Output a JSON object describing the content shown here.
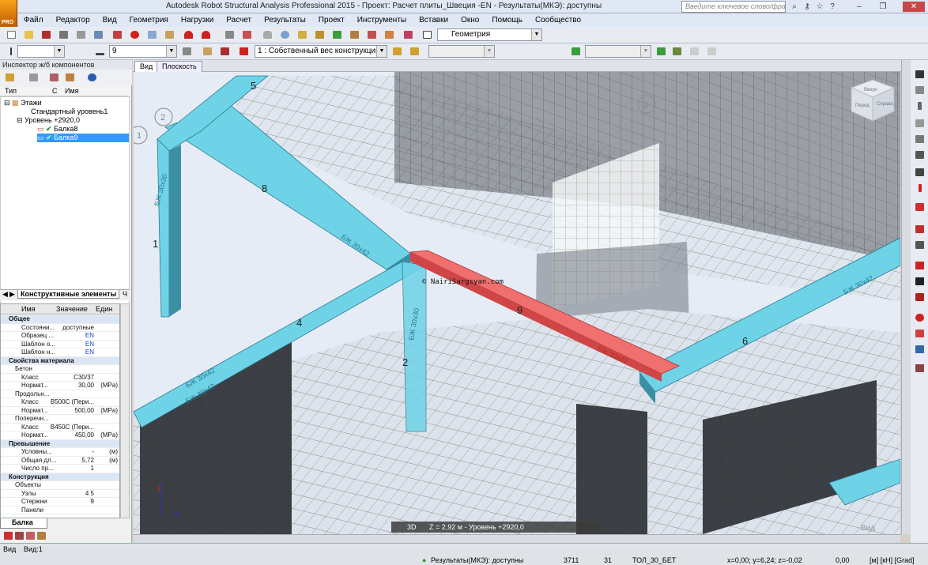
{
  "window": {
    "title": "Autodesk Robot Structural Analysis Professional 2015 - Проект: Расчет плиты_Швеция -EN - Результаты(МКЭ): доступны",
    "help_placeholder": "Введите ключевое слово/фразу",
    "logo_text": "PRO"
  },
  "menu": [
    "Файл",
    "Редактор",
    "Вид",
    "Геометрия",
    "Нагрузки",
    "Расчет",
    "Результаты",
    "Проект",
    "Инструменты",
    "Вставки",
    "Окно",
    "Помощь",
    "Сообщество"
  ],
  "toolbar": {
    "layout_combo": "Геометрия",
    "section_combo": "9",
    "load_case_combo": "1 : Собственный вес конструкций"
  },
  "inspector": {
    "title": "Инспектор ж/б компонентов",
    "columns": {
      "type": "Тип",
      "c": "С",
      "name": "Имя"
    },
    "tree": {
      "root": "Этажи",
      "level1": "Стандартный уровень1",
      "level2": "Уровень +2920,0",
      "items": [
        "Балка8",
        "Балка9"
      ]
    },
    "tab_active": "Конструктивные элементы",
    "tab_other": "Ч"
  },
  "properties": {
    "headers": {
      "name": "Имя",
      "value": "Значение",
      "unit": "Един"
    },
    "rows": [
      {
        "kind": "group",
        "name": "Общее"
      },
      {
        "kind": "row",
        "name": "Состояни...",
        "value": "доступные",
        "unit": "",
        "blue": false
      },
      {
        "kind": "row",
        "name": "Образец ...",
        "value": "EN",
        "unit": "",
        "blue": true
      },
      {
        "kind": "row",
        "name": "Шаблон о...",
        "value": "EN",
        "unit": "",
        "blue": true
      },
      {
        "kind": "row",
        "name": "Шаблон н...",
        "value": "EN",
        "unit": "",
        "blue": true
      },
      {
        "kind": "group",
        "name": "Свойства материала"
      },
      {
        "kind": "sub",
        "name": "Бетон"
      },
      {
        "kind": "row",
        "name": "Класс",
        "value": "C30/37",
        "unit": "",
        "blue": false
      },
      {
        "kind": "row",
        "name": "Нормат...",
        "value": "30,00",
        "unit": "(MPa)",
        "blue": false
      },
      {
        "kind": "sub",
        "name": "Продольн..."
      },
      {
        "kind": "row",
        "name": "Класс",
        "value": "B500C (Пери...",
        "unit": "",
        "blue": false
      },
      {
        "kind": "row",
        "name": "Нормат...",
        "value": "500,00",
        "unit": "(MPa)",
        "blue": false
      },
      {
        "kind": "sub",
        "name": "Поперечн..."
      },
      {
        "kind": "row",
        "name": "Класс",
        "value": "B450C (Пери...",
        "unit": "",
        "blue": false
      },
      {
        "kind": "row",
        "name": "Нормат...",
        "value": "450,00",
        "unit": "(MPa)",
        "blue": false
      },
      {
        "kind": "group",
        "name": "Превышение"
      },
      {
        "kind": "row",
        "name": "Условны...",
        "value": "-",
        "unit": "(м)",
        "blue": false
      },
      {
        "kind": "row",
        "name": "Общая дл...",
        "value": "5,72",
        "unit": "(м)",
        "blue": false
      },
      {
        "kind": "row",
        "name": "Число пр...",
        "value": "1",
        "unit": "",
        "blue": false
      },
      {
        "kind": "group",
        "name": "Конструкция"
      },
      {
        "kind": "sub",
        "name": "Объекты"
      },
      {
        "kind": "row",
        "name": "Узлы",
        "value": "4 5",
        "unit": "",
        "blue": false
      },
      {
        "kind": "row",
        "name": "Стержни",
        "value": "9",
        "unit": "",
        "blue": false
      },
      {
        "kind": "row",
        "name": "Панели",
        "value": "",
        "unit": "",
        "blue": false
      }
    ],
    "tab": "Балка"
  },
  "view": {
    "tabs": [
      "Вид",
      "Плоскость"
    ],
    "viewcube": {
      "top": "Вверх",
      "front": "Перед",
      "right": "Справа"
    },
    "grid_labels": [
      "2",
      "2",
      "1"
    ],
    "member_numbers": [
      "5",
      "8",
      "1",
      "4",
      "2",
      "9",
      "6"
    ],
    "section_labels": [
      "БЖ 30х30",
      "БЖ 30х42",
      "БЖ 30х42",
      "БЖ 30х42",
      "БЖ 30х42",
      "БЖ 30х30",
      "БЖ 30х42"
    ],
    "watermark": "© NairiSargsyan.com",
    "info_mode": "3D",
    "info_text": "Z = 2,92 м - Уровень +2920,0",
    "corner_label": "Вид"
  },
  "status": {
    "tabs": [
      "Вид",
      "Вид:1"
    ],
    "results": "Результаты(МКЭ): доступны",
    "nodes": "3711",
    "bars": "31",
    "section": "ТОЛ_30_БЕТ",
    "coords": "x=0,00; y=6,24; z=-0,02",
    "value": "0,00",
    "units": "[м] [кН] [Grad]"
  },
  "colors": {
    "beam": "#6fd3e8",
    "beam_dark": "#3a8fa3",
    "selected_beam": "#f07070",
    "mesh": "#3a4a20",
    "slab": "#dde4ee",
    "wall": "#3c3f45"
  }
}
